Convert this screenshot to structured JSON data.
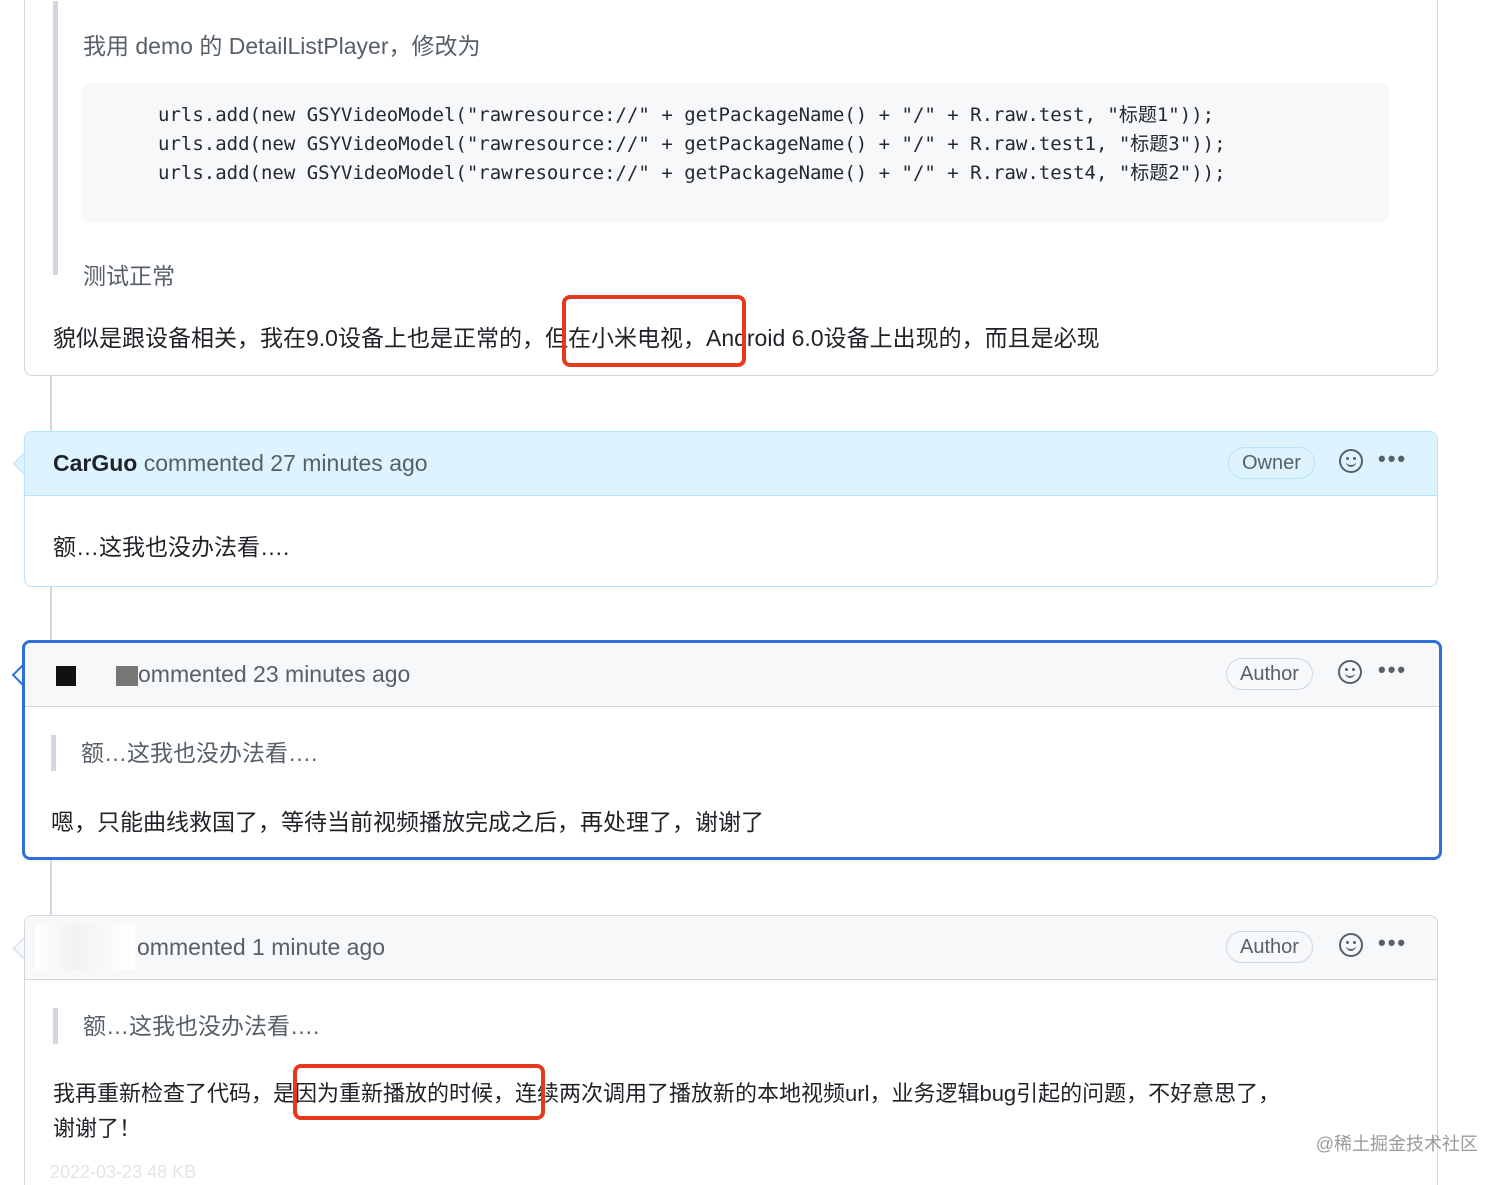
{
  "comment1": {
    "quote_intro": "我用 demo 的 DetailListPlayer，修改为",
    "code_lines": [
      "urls.add(new GSYVideoModel(\"rawresource://\" + getPackageName() + \"/\" + R.raw.test, \"标题1\"));",
      "urls.add(new GSYVideoModel(\"rawresource://\" + getPackageName() + \"/\" + R.raw.test1, \"标题3\"));",
      "urls.add(new GSYVideoModel(\"rawresource://\" + getPackageName() + \"/\" + R.raw.test4, \"标题2\"));"
    ],
    "quote_result": "测试正常",
    "body": "貌似是跟设备相关，我在9.0设备上也是正常的，但在小米电视，Android 6.0设备上出现的，而且是必现"
  },
  "comment2": {
    "author": "CarGuo",
    "action": "commented 27 minutes ago",
    "badge": "Owner",
    "body": "额…这我也没办法看…."
  },
  "comment3": {
    "action": "ommented 23 minutes ago",
    "badge": "Author",
    "quote": "额…这我也没办法看….",
    "body": "嗯，只能曲线救国了，等待当前视频播放完成之后，再处理了，谢谢了"
  },
  "comment4": {
    "action": "ommented 1 minute ago",
    "badge": "Author",
    "quote": "额…这我也没办法看….",
    "body_line1": "我再重新检查了代码，是因为重新播放的时候，连续两次调用了播放新的本地视频url，业务逻辑bug引起的问题，不好意思了，",
    "body_line2": "谢谢了！"
  },
  "footer": "2022-03-23      48 KB",
  "watermark": "@稀土掘金技术社区",
  "icons": [
    "smiley-icon",
    "kebab-menu-icon"
  ],
  "colors": {
    "owner_header": "#ddf4ff",
    "focus_border": "#2f6fd8",
    "highlight_box": "#e5391e"
  }
}
